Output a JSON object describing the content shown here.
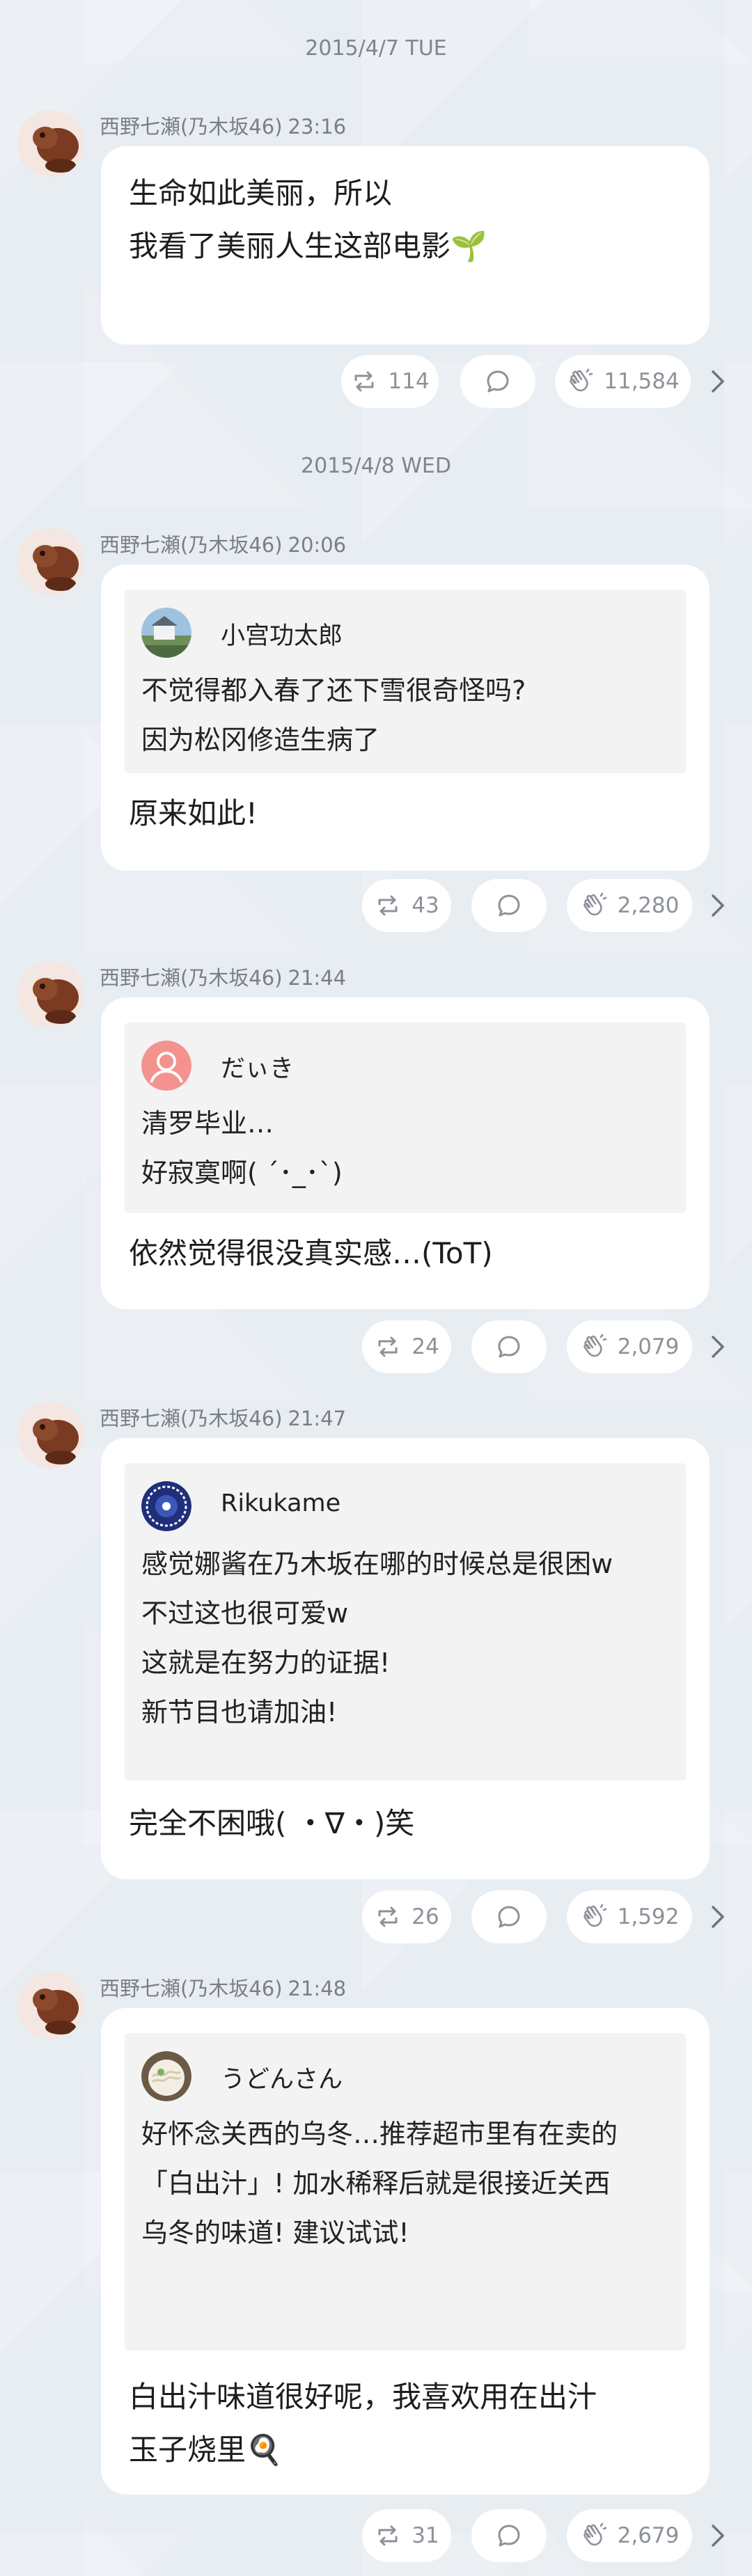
{
  "colors": {
    "background": "#e8edf2",
    "bubble": "#ffffff",
    "quote_bg": "#f3f3f3",
    "muted": "#7f858c"
  },
  "icons": {
    "repost": "repost-icon",
    "comment": "comment-icon",
    "clap": "clap-icon",
    "chevron": "chevron-right-icon"
  },
  "posts": [
    {
      "date": "2015/4/7 TUE",
      "author": "西野七瀬(乃木坂46)",
      "time": "23:16",
      "message": [
        "生命如此美丽，所以",
        "我看了美丽人生这部电影🌱"
      ],
      "reposts": "114",
      "claps": "11,584"
    },
    {
      "date": "2015/4/8 WED",
      "author": "西野七瀬(乃木坂46)",
      "time": "20:06",
      "quote": {
        "name": "小宫功太郎",
        "avatar": "landscape-avatar",
        "lines": [
          "不觉得都入春了还下雪很奇怪吗?",
          "因为松冈修造生病了"
        ]
      },
      "message": [
        "原来如此!"
      ],
      "reposts": "43",
      "claps": "2,280"
    },
    {
      "author": "西野七瀬(乃木坂46)",
      "time": "21:44",
      "quote": {
        "name": "だぃき",
        "avatar": "default-user-avatar",
        "lines": [
          "清罗毕业…",
          "好寂寞啊( ´･_･`)"
        ]
      },
      "message": [
        "依然觉得很没真实感…(ToT)"
      ],
      "reposts": "24",
      "claps": "2,079"
    },
    {
      "author": "西野七瀬(乃木坂46)",
      "time": "21:47",
      "quote": {
        "name": "Rikukame",
        "avatar": "emblem-avatar",
        "lines": [
          "感觉娜酱在乃木坂在哪的时候总是很困w",
          "不过这也很可爱w",
          "这就是在努力的证据!",
          "新节目也请加油!"
        ]
      },
      "message": [
        "完全不困哦( ・∇・)笑"
      ],
      "reposts": "26",
      "claps": "1,592"
    },
    {
      "author": "西野七瀬(乃木坂46)",
      "time": "21:48",
      "quote": {
        "name": "うどんさん",
        "avatar": "noodle-avatar",
        "lines": [
          "好怀念关西的乌冬…推荐超市里有在卖的",
          "「白出汁」! 加水稀释后就是很接近关西",
          "乌冬的味道! 建议试试!"
        ]
      },
      "message": [
        "白出汁味道很好呢，我喜欢用在出汁",
        "玉子烧里🍳"
      ],
      "reposts": "31",
      "claps": "2,679"
    }
  ]
}
